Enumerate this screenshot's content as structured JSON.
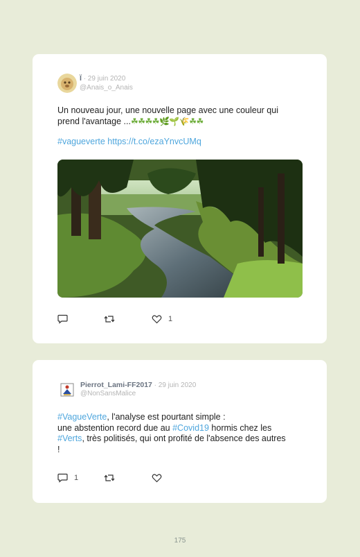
{
  "tweet1": {
    "author": "Ï",
    "date": "· 29 juin 2020",
    "handle": "@Anais_o_Anais",
    "line1": "Un nouveau jour, une nouvelle page avec une couleur qui",
    "line2": "prend l'avantage ...",
    "emoji": "☘☘☘☘🌿🌱🌾☘☘",
    "hashtag": "#vagueverte",
    "link": "https://t.co/ezaYnvcUMq",
    "likes": "1"
  },
  "tweet2": {
    "author": "Pierrot_Lami-FF2017",
    "date": "· 29 juin 2020",
    "handle": "@NonSansMalice",
    "tag1": "#VagueVerte",
    "text1": ", l'analyse est pourtant simple :",
    "text2": "une abstention record due au ",
    "tag2": "#Covid19",
    "text3": " hormis chez les",
    "tag3": "#Verts",
    "text4": ", très politisés, qui ont profité de l'absence des autres",
    "text5": "!",
    "replies": "1"
  },
  "page_number": "175"
}
